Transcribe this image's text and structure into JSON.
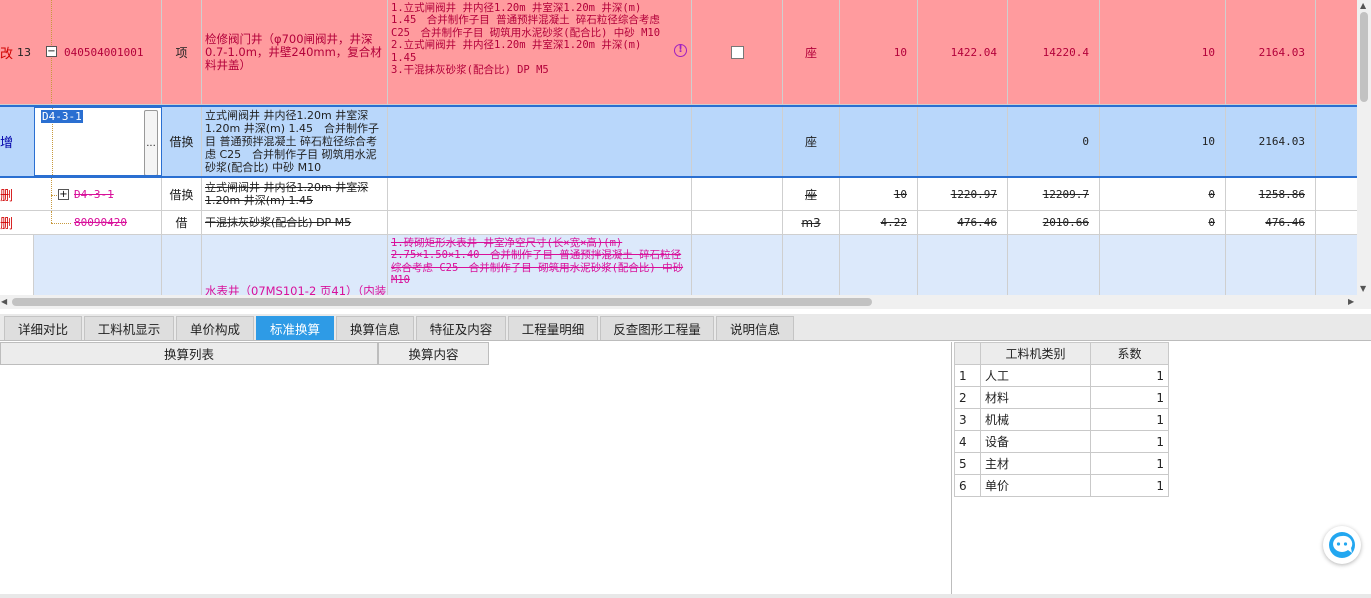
{
  "rows": [
    {
      "status": "改",
      "seq": "13",
      "code": "040504001001",
      "type": "项",
      "name": "检修阀门井（φ700闸阀井，井深0.7-1.0m，井壁240mm，复合材料井盖）",
      "feature": "1.立式闸阀井 井内径1.20m 井室深1.20m 井深(m) 1.45　合并制作子目 普通预拌混凝土 碎石粒径综合考虑 C25　合并制作子目 砌筑用水泥砂浆(配合比) 中砂 M10\n2.立式闸阀井 井内径1.20m 井室深1.20m 井深(m) 1.45\n3.干混抹灰砂浆(配合比) DP M5",
      "unit": "座",
      "qty_expr": "10",
      "price": "1422.04",
      "total": "14220.4",
      "qty2": "10",
      "price2": "2164.03"
    },
    {
      "status": "增",
      "code": "D4-3-1",
      "expand_button": "...",
      "type": "借换",
      "name": "立式闸阀井 井内径1.20m 井室深1.20m 井深(m) 1.45　合并制作子目 普通预拌混凝土 碎石粒径综合考虑 C25　合并制作子目 砌筑用水泥砂浆(配合比) 中砂 M10",
      "unit": "座",
      "total": "0",
      "qty2": "10",
      "price2": "2164.03"
    },
    {
      "status": "删",
      "code": "D4-3-1",
      "type": "借换",
      "name": "立式闸阀井 井内径1.20m 井室深1.20m 井深(m) 1.45",
      "unit": "座",
      "qty_expr": "10",
      "price": "1220.97",
      "total": "12209.7",
      "qty2": "0",
      "price2": "1258.86"
    },
    {
      "status": "删",
      "code": "80090420",
      "type": "借",
      "name": "干混抹灰砂浆(配合比) DP M5",
      "unit": "m3",
      "qty_expr": "4.22",
      "price": "476.46",
      "total": "2010.66",
      "qty2": "0",
      "price2": "476.46"
    },
    {
      "feature": "1.砖砌矩形水表井 井室净空尺寸(长×宽×高)(m) 2.75×1.50×1.40　合并制作子目 普通预拌混凝土 碎石粒径综合考虑 C25　合并制作子目 砌筑用水泥砂浆(配合比) 中砂 M10",
      "name": "水表井（07MS101-2 页41）（内装"
    }
  ],
  "tabs": [
    "详细对比",
    "工料机显示",
    "单价构成",
    "标准换算",
    "换算信息",
    "特征及内容",
    "工程量明细",
    "反查图形工程量",
    "说明信息"
  ],
  "active_tab": "标准换算",
  "calc_table": {
    "col1": "换算列表",
    "col2": "换算内容"
  },
  "coef_table": {
    "col_type": "工料机类别",
    "col_coef": "系数",
    "rows": [
      {
        "no": "1",
        "type": "人工",
        "coef": "1"
      },
      {
        "no": "2",
        "type": "材料",
        "coef": "1"
      },
      {
        "no": "3",
        "type": "机械",
        "coef": "1"
      },
      {
        "no": "4",
        "type": "设备",
        "coef": "1"
      },
      {
        "no": "5",
        "type": "主材",
        "coef": "1"
      },
      {
        "no": "6",
        "type": "单价",
        "coef": "1"
      }
    ]
  },
  "warning_icon": "exclamation-circle-icon",
  "assistant_icon": "chat-bubble-icon",
  "colors": {
    "row_modified": "#ff9b9e",
    "row_selected": "#b9d7fb",
    "row_light": "#dce9fb",
    "tab_active": "#2e9be6",
    "deleted_text": "#d8109a"
  }
}
